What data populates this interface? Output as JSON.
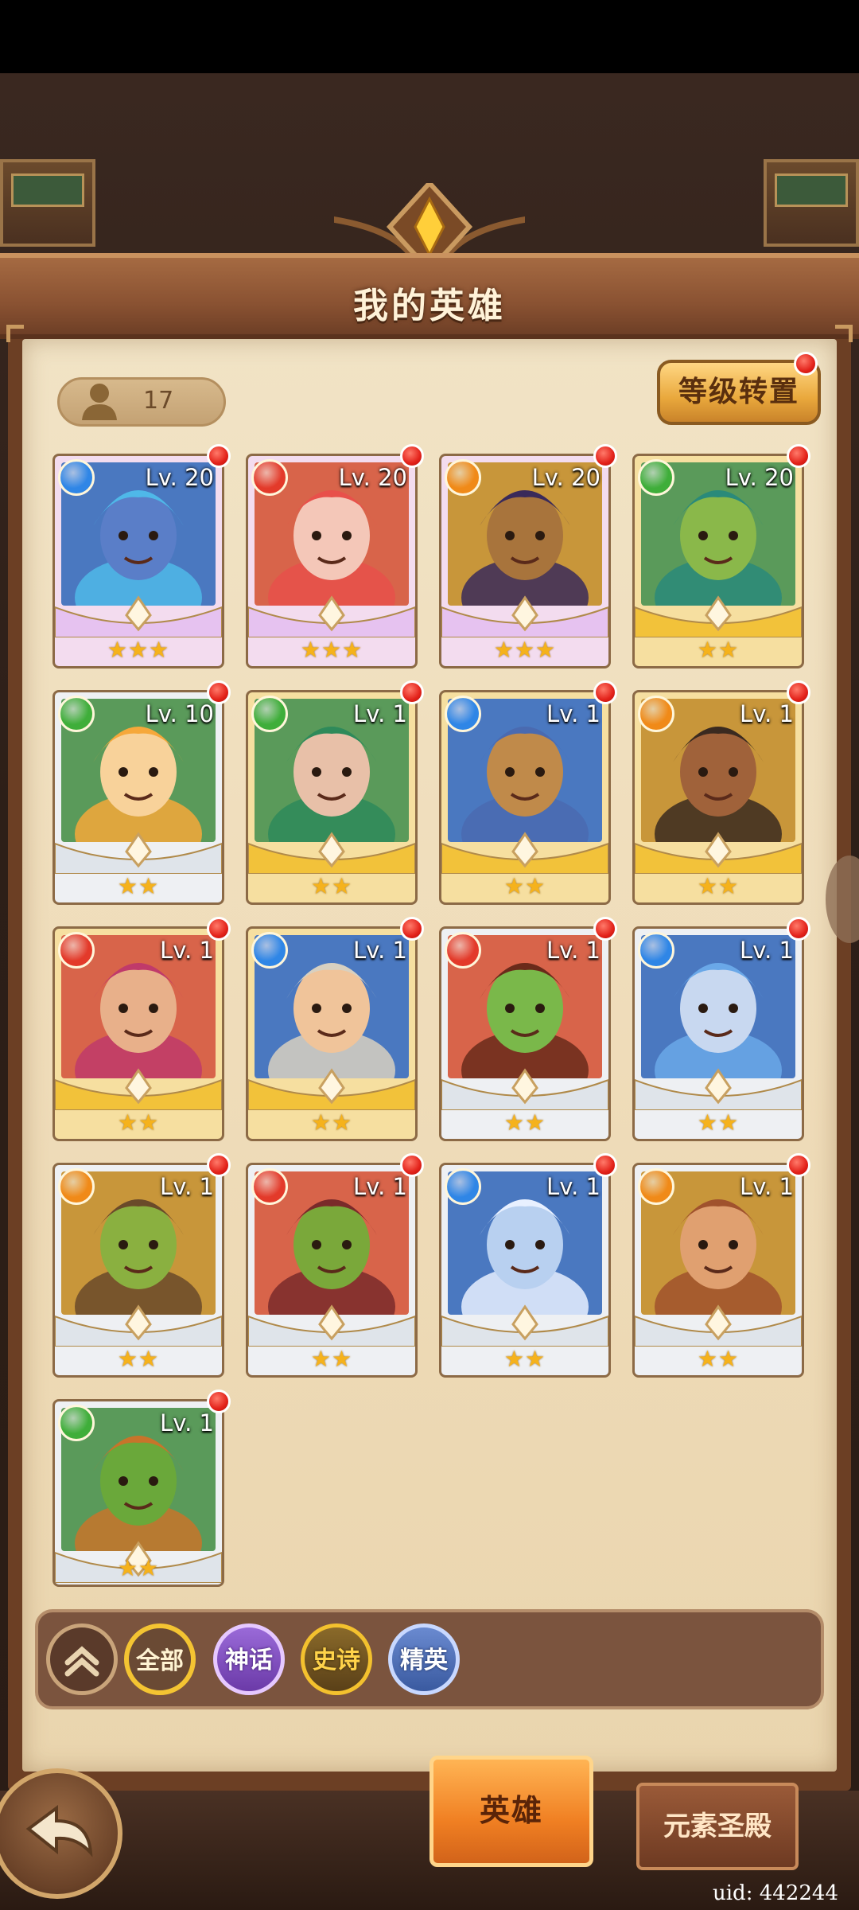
{
  "header": {
    "title": "我的英雄"
  },
  "hero_count": "17",
  "level_transfer_button": "等级转置",
  "heroes": [
    {
      "level": "Lv. 20",
      "element": "water",
      "rarity": "mythic",
      "stars": "★★★",
      "skin": "#5a7ec8",
      "hair": "#4fb8e8"
    },
    {
      "level": "Lv. 20",
      "element": "fire",
      "rarity": "mythic",
      "stars": "★★★",
      "skin": "#f4c7b8",
      "hair": "#e8504a"
    },
    {
      "level": "Lv. 20",
      "element": "light",
      "rarity": "mythic",
      "stars": "★★★",
      "skin": "#a8743c",
      "hair": "#3a2a5a"
    },
    {
      "level": "Lv. 20",
      "element": "wind",
      "rarity": "epic",
      "stars": "★★",
      "skin": "#8ab84a",
      "hair": "#2a8a7a"
    },
    {
      "level": "Lv. 10",
      "element": "wind",
      "rarity": "elite",
      "stars": "★★",
      "skin": "#f8d29a",
      "hair": "#f6a83a"
    },
    {
      "level": "Lv. 1",
      "element": "wind",
      "rarity": "epic",
      "stars": "★★",
      "skin": "#e8c0a8",
      "hair": "#2e8a5a"
    },
    {
      "level": "Lv. 1",
      "element": "water",
      "rarity": "epic",
      "stars": "★★",
      "skin": "#c08a4a",
      "hair": "#4a6ab0"
    },
    {
      "level": "Lv. 1",
      "element": "light",
      "rarity": "epic",
      "stars": "★★",
      "skin": "#a0623a",
      "hair": "#3a2a20"
    },
    {
      "level": "Lv. 1",
      "element": "fire",
      "rarity": "epic",
      "stars": "★★",
      "skin": "#e8b08a",
      "hair": "#c03a6a"
    },
    {
      "level": "Lv. 1",
      "element": "water",
      "rarity": "epic",
      "stars": "★★",
      "skin": "#f0c49a",
      "hair": "#d8d0c0"
    },
    {
      "level": "Lv. 1",
      "element": "fire",
      "rarity": "elite",
      "stars": "★★",
      "skin": "#7ab84a",
      "hair": "#6a2a1a"
    },
    {
      "level": "Lv. 1",
      "element": "water",
      "rarity": "elite",
      "stars": "★★",
      "skin": "#c8d8f0",
      "hair": "#6aa8e8"
    },
    {
      "level": "Lv. 1",
      "element": "light",
      "rarity": "elite",
      "stars": "★★",
      "skin": "#8ab040",
      "hair": "#6a4a2a"
    },
    {
      "level": "Lv. 1",
      "element": "fire",
      "rarity": "elite",
      "stars": "★★",
      "skin": "#7aa83a",
      "hair": "#7a2a2a"
    },
    {
      "level": "Lv. 1",
      "element": "water",
      "rarity": "elite",
      "stars": "★★",
      "skin": "#b8d0f0",
      "hair": "#e8f0ff"
    },
    {
      "level": "Lv. 1",
      "element": "light",
      "rarity": "elite",
      "stars": "★★",
      "skin": "#e0a070",
      "hair": "#a0522d"
    },
    {
      "level": "Lv. 1",
      "element": "wind",
      "rarity": "elite",
      "stars": "★★",
      "skin": "#6aa83a",
      "hair": "#c8742a"
    }
  ],
  "filters": {
    "all": "全部",
    "mythic": "神话",
    "epic": "史诗",
    "elite": "精英"
  },
  "tabs": {
    "heroes": "英雄",
    "element_temple": "元素圣殿"
  },
  "uid": "uid: 442244",
  "element_colors": {
    "water": "#2f86e6",
    "fire": "#e33a2a",
    "light": "#f08a18",
    "wind": "#3fae3a"
  },
  "rarity_colors": {
    "mythic": "#e6c2f0",
    "epic": "#f2c23a",
    "elite": "#dfe4ea"
  }
}
